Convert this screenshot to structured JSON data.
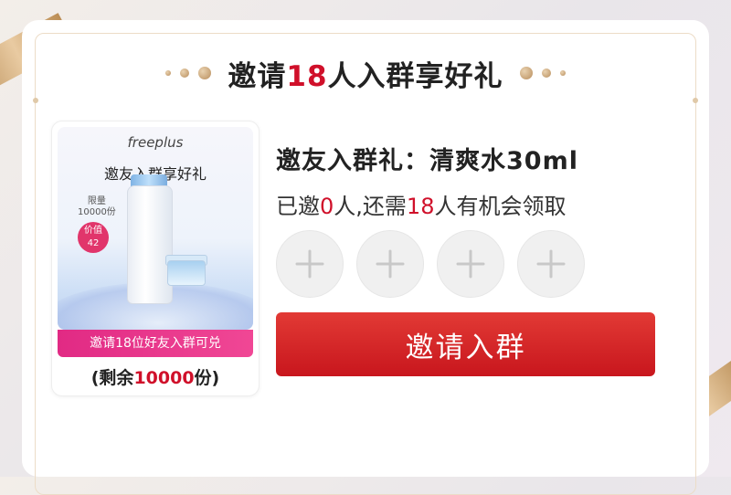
{
  "header": {
    "title_prefix": "邀请",
    "title_number": "18",
    "title_suffix": "人入群享好礼"
  },
  "product": {
    "brand": "freeplus",
    "image_headline": "邀友入群享好礼",
    "limit_line1": "限量",
    "limit_line2": "10000份",
    "value_line1": "价值",
    "value_line2": "42",
    "banner": "邀请18位好友入群可兑",
    "remaining_prefix": "(剩余",
    "remaining_number": "10000",
    "remaining_suffix": "份)"
  },
  "gift": {
    "title": "邀友入群礼：清爽水30ml",
    "progress_a": "已邀",
    "progress_invited": "0",
    "progress_b": "人,还需",
    "progress_needed": "18",
    "progress_c": "人有机会领取"
  },
  "slots": {
    "count": 4,
    "icon": "plus-icon"
  },
  "actions": {
    "invite_label": "邀请入群"
  },
  "colors": {
    "accent_red": "#d0102a",
    "button_red": "#d3222a",
    "banner_pink": "#e12a84",
    "gold": "#b88d5c"
  }
}
